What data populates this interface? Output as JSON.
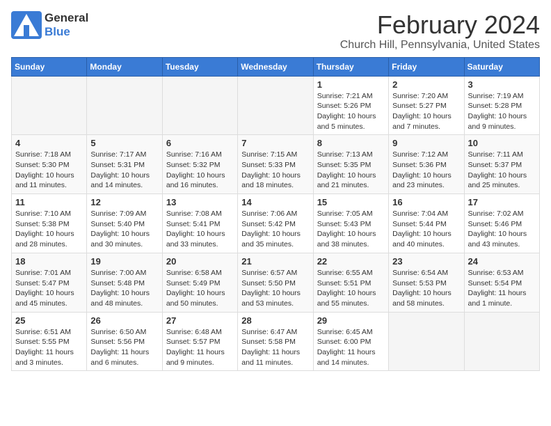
{
  "app": {
    "logo_general": "General",
    "logo_blue": "Blue",
    "title": "February 2024",
    "subtitle": "Church Hill, Pennsylvania, United States"
  },
  "calendar": {
    "headers": [
      "Sunday",
      "Monday",
      "Tuesday",
      "Wednesday",
      "Thursday",
      "Friday",
      "Saturday"
    ],
    "weeks": [
      [
        {
          "day": "",
          "info": ""
        },
        {
          "day": "",
          "info": ""
        },
        {
          "day": "",
          "info": ""
        },
        {
          "day": "",
          "info": ""
        },
        {
          "day": "1",
          "info": "Sunrise: 7:21 AM\nSunset: 5:26 PM\nDaylight: 10 hours\nand 5 minutes."
        },
        {
          "day": "2",
          "info": "Sunrise: 7:20 AM\nSunset: 5:27 PM\nDaylight: 10 hours\nand 7 minutes."
        },
        {
          "day": "3",
          "info": "Sunrise: 7:19 AM\nSunset: 5:28 PM\nDaylight: 10 hours\nand 9 minutes."
        }
      ],
      [
        {
          "day": "4",
          "info": "Sunrise: 7:18 AM\nSunset: 5:30 PM\nDaylight: 10 hours\nand 11 minutes."
        },
        {
          "day": "5",
          "info": "Sunrise: 7:17 AM\nSunset: 5:31 PM\nDaylight: 10 hours\nand 14 minutes."
        },
        {
          "day": "6",
          "info": "Sunrise: 7:16 AM\nSunset: 5:32 PM\nDaylight: 10 hours\nand 16 minutes."
        },
        {
          "day": "7",
          "info": "Sunrise: 7:15 AM\nSunset: 5:33 PM\nDaylight: 10 hours\nand 18 minutes."
        },
        {
          "day": "8",
          "info": "Sunrise: 7:13 AM\nSunset: 5:35 PM\nDaylight: 10 hours\nand 21 minutes."
        },
        {
          "day": "9",
          "info": "Sunrise: 7:12 AM\nSunset: 5:36 PM\nDaylight: 10 hours\nand 23 minutes."
        },
        {
          "day": "10",
          "info": "Sunrise: 7:11 AM\nSunset: 5:37 PM\nDaylight: 10 hours\nand 25 minutes."
        }
      ],
      [
        {
          "day": "11",
          "info": "Sunrise: 7:10 AM\nSunset: 5:38 PM\nDaylight: 10 hours\nand 28 minutes."
        },
        {
          "day": "12",
          "info": "Sunrise: 7:09 AM\nSunset: 5:40 PM\nDaylight: 10 hours\nand 30 minutes."
        },
        {
          "day": "13",
          "info": "Sunrise: 7:08 AM\nSunset: 5:41 PM\nDaylight: 10 hours\nand 33 minutes."
        },
        {
          "day": "14",
          "info": "Sunrise: 7:06 AM\nSunset: 5:42 PM\nDaylight: 10 hours\nand 35 minutes."
        },
        {
          "day": "15",
          "info": "Sunrise: 7:05 AM\nSunset: 5:43 PM\nDaylight: 10 hours\nand 38 minutes."
        },
        {
          "day": "16",
          "info": "Sunrise: 7:04 AM\nSunset: 5:44 PM\nDaylight: 10 hours\nand 40 minutes."
        },
        {
          "day": "17",
          "info": "Sunrise: 7:02 AM\nSunset: 5:46 PM\nDaylight: 10 hours\nand 43 minutes."
        }
      ],
      [
        {
          "day": "18",
          "info": "Sunrise: 7:01 AM\nSunset: 5:47 PM\nDaylight: 10 hours\nand 45 minutes."
        },
        {
          "day": "19",
          "info": "Sunrise: 7:00 AM\nSunset: 5:48 PM\nDaylight: 10 hours\nand 48 minutes."
        },
        {
          "day": "20",
          "info": "Sunrise: 6:58 AM\nSunset: 5:49 PM\nDaylight: 10 hours\nand 50 minutes."
        },
        {
          "day": "21",
          "info": "Sunrise: 6:57 AM\nSunset: 5:50 PM\nDaylight: 10 hours\nand 53 minutes."
        },
        {
          "day": "22",
          "info": "Sunrise: 6:55 AM\nSunset: 5:51 PM\nDaylight: 10 hours\nand 55 minutes."
        },
        {
          "day": "23",
          "info": "Sunrise: 6:54 AM\nSunset: 5:53 PM\nDaylight: 10 hours\nand 58 minutes."
        },
        {
          "day": "24",
          "info": "Sunrise: 6:53 AM\nSunset: 5:54 PM\nDaylight: 11 hours\nand 1 minute."
        }
      ],
      [
        {
          "day": "25",
          "info": "Sunrise: 6:51 AM\nSunset: 5:55 PM\nDaylight: 11 hours\nand 3 minutes."
        },
        {
          "day": "26",
          "info": "Sunrise: 6:50 AM\nSunset: 5:56 PM\nDaylight: 11 hours\nand 6 minutes."
        },
        {
          "day": "27",
          "info": "Sunrise: 6:48 AM\nSunset: 5:57 PM\nDaylight: 11 hours\nand 9 minutes."
        },
        {
          "day": "28",
          "info": "Sunrise: 6:47 AM\nSunset: 5:58 PM\nDaylight: 11 hours\nand 11 minutes."
        },
        {
          "day": "29",
          "info": "Sunrise: 6:45 AM\nSunset: 6:00 PM\nDaylight: 11 hours\nand 14 minutes."
        },
        {
          "day": "",
          "info": ""
        },
        {
          "day": "",
          "info": ""
        }
      ]
    ]
  }
}
